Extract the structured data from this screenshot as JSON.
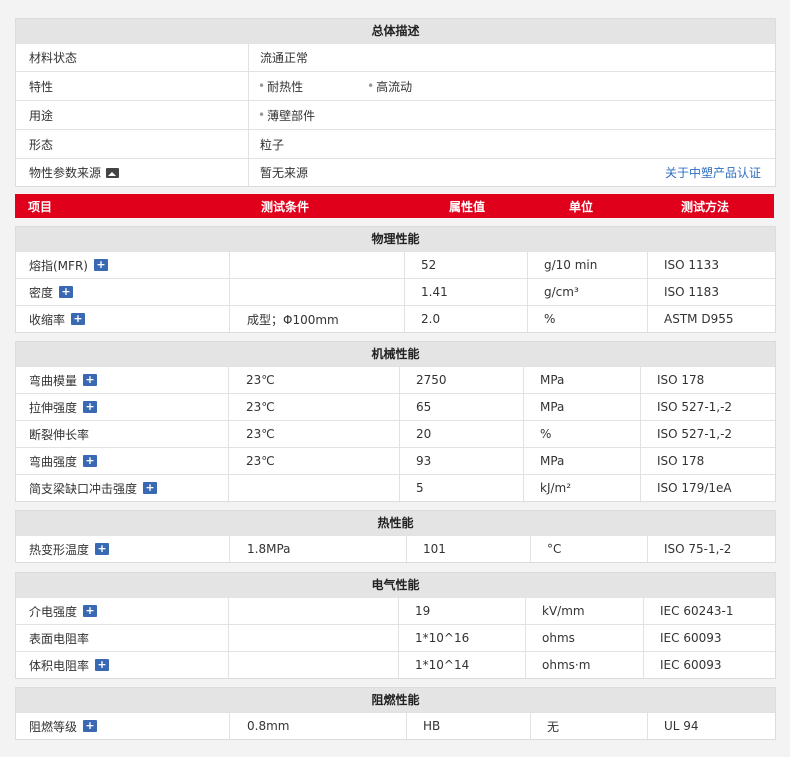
{
  "overview": {
    "title": "总体描述",
    "material_state_label": "材料状态",
    "material_state_value": "流通正常",
    "features_label": "特性",
    "feature_1": "耐热性",
    "feature_2": "高流动",
    "usage_label": "用途",
    "usage_1": "薄壁部件",
    "form_label": "形态",
    "form_value": "粒子",
    "source_label": "物性参数来源",
    "source_value": "暂无来源",
    "source_link": "关于中塑产品认证"
  },
  "header": {
    "item": "项目",
    "condition": "测试条件",
    "value": "属性值",
    "unit": "单位",
    "method": "测试方法"
  },
  "physical": {
    "title": "物理性能",
    "rows": [
      {
        "name": "熔指(MFR)",
        "cond": "",
        "val": "52",
        "unit": "g/10 min",
        "method": "ISO 1133"
      },
      {
        "name": "密度",
        "cond": "",
        "val": "1.41",
        "unit": "g/cm³",
        "method": "ISO 1183"
      },
      {
        "name": "收缩率",
        "cond": "成型；Φ100mm",
        "val": "2.0",
        "unit": "%",
        "method": "ASTM D955"
      }
    ]
  },
  "mechanical": {
    "title": "机械性能",
    "rows": [
      {
        "name": "弯曲模量",
        "cond": "23℃",
        "val": "2750",
        "unit": "MPa",
        "method": "ISO 178"
      },
      {
        "name": "拉伸强度",
        "cond": "23℃",
        "val": "65",
        "unit": "MPa",
        "method": "ISO 527-1,-2"
      },
      {
        "name": "断裂伸长率",
        "cond": "23℃",
        "val": "20",
        "unit": "%",
        "method": "ISO 527-1,-2"
      },
      {
        "name": "弯曲强度",
        "cond": "23℃",
        "val": "93",
        "unit": "MPa",
        "method": "ISO 178"
      },
      {
        "name": "简支梁缺口冲击强度",
        "cond": "",
        "val": "5",
        "unit": "kJ/m²",
        "method": "ISO 179/1eA"
      }
    ]
  },
  "thermal": {
    "title": "热性能",
    "rows": [
      {
        "name": "热变形温度",
        "cond": "1.8MPa",
        "val": "101",
        "unit": "°C",
        "method": "ISO 75-1,-2"
      }
    ]
  },
  "electrical": {
    "title": "电气性能",
    "rows": [
      {
        "name": "介电强度",
        "cond": "",
        "val": "19",
        "unit": "kV/mm",
        "method": "IEC 60243-1"
      },
      {
        "name": "表面电阻率",
        "cond": "",
        "val": "1*10^16",
        "unit": "ohms",
        "method": "IEC 60093"
      },
      {
        "name": "体积电阻率",
        "cond": "",
        "val": "1*10^14",
        "unit": "ohms·m",
        "method": "IEC 60093"
      }
    ]
  },
  "flame": {
    "title": "阻燃性能",
    "rows": [
      {
        "name": "阻燃等级",
        "cond": "0.8mm",
        "val": "HB",
        "unit": "无",
        "method": "UL 94"
      }
    ]
  }
}
